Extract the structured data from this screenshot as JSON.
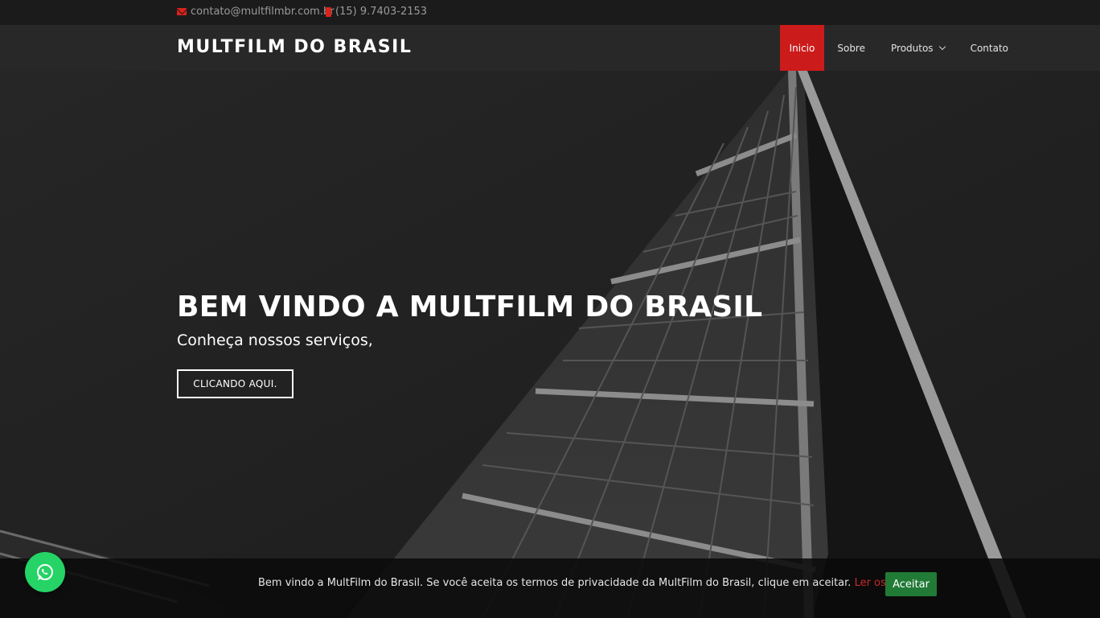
{
  "topbar": {
    "email": "contato@multfilmbr.com.br",
    "phone": "(15) 9.7403-2153",
    "email_icon": "envelope-icon",
    "phone_icon": "mobile-phone-icon"
  },
  "navbar": {
    "brand": "MULTFILM DO BRASIL",
    "items": [
      {
        "label": "Inicio",
        "active": true
      },
      {
        "label": "Sobre"
      },
      {
        "label": "Produtos",
        "dropdown": true
      },
      {
        "label": "Contato"
      }
    ]
  },
  "hero": {
    "title": "BEM VINDO A MULTFILM DO BRASIL",
    "subtitle": "Conheça nossos serviços,",
    "button": "CLICANDO AQUI."
  },
  "cookie": {
    "message": "Bem vindo a MultFilm do Brasil. Se você aceita os termos de privacidade da MultFilm do Brasil, clique em aceitar. ",
    "terms_link": "Ler os termos",
    "suffix": ".",
    "accept": "Aceitar"
  },
  "whatsapp": {
    "icon": "whatsapp-icon"
  },
  "colors": {
    "accent": "#cc1b1b",
    "accept": "#217a36",
    "whatsapp": "#25d366"
  }
}
